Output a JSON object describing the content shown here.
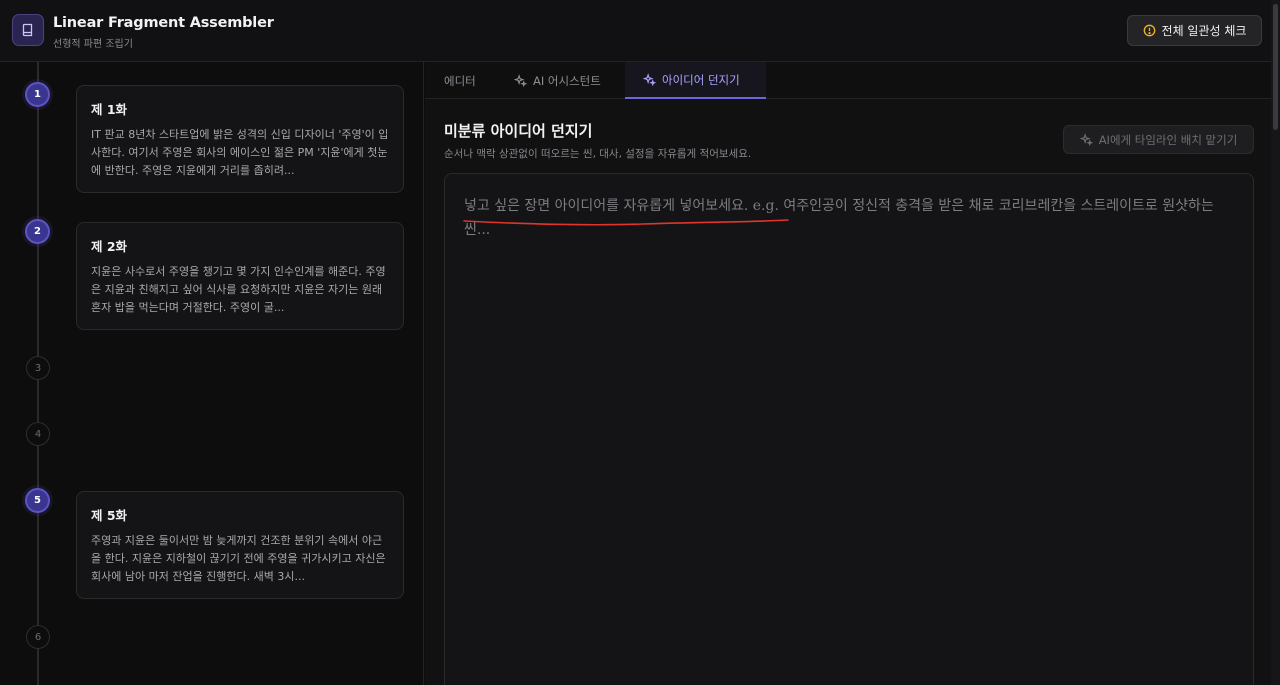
{
  "header": {
    "title": "Linear Fragment Assembler",
    "subtitle": "선형적 파편 조립기",
    "logo_icon": "book-icon",
    "consistency_button": "전체 일관성 체크",
    "consistency_icon": "alert-circle-icon"
  },
  "timeline": {
    "nodes": [
      {
        "number": "1",
        "active": true,
        "title": "제 1화",
        "body": "IT 판교 8년차 스타트업에 밝은 성격의 신입 디자이너 '주영'이 입사한다. 여기서 주영은 회사의 에이스인 젊은 PM '지윤'에게 첫눈에 반한다. 주영은 지윤에게 거리를 좁히려..."
      },
      {
        "number": "2",
        "active": true,
        "title": "제 2화",
        "body": "지윤은 사수로서 주영을 챙기고 몇 가지 인수인계를 해준다. 주영은 지윤과 친해지고 싶어 식사를 요청하지만 지윤은 자기는 원래 혼자 밥을 먹는다며 거절한다. 주영이 굴..."
      },
      {
        "number": "3",
        "active": false
      },
      {
        "number": "4",
        "active": false
      },
      {
        "number": "5",
        "active": true,
        "title": "제 5화",
        "body": "주영과 지윤은 둘이서만 밤 늦게까지 건조한 분위기 속에서 야근을 한다. 지윤은 지하철이 끊기기 전에 주영을 귀가시키고 자신은 회사에 남아 마저 잔업을 진행한다. 새벽 3시..."
      },
      {
        "number": "6",
        "active": false
      }
    ]
  },
  "tabs": [
    {
      "label": "에디터",
      "icon": ""
    },
    {
      "label": "AI 어시스턴트",
      "icon": "sparkles-icon"
    },
    {
      "label": "아이디어 던지기",
      "icon": "sparkles-icon",
      "active": true
    }
  ],
  "idea": {
    "title": "미분류 아이디어 던지기",
    "description": "순서나 맥락 상관없이 떠오르는 씬, 대사, 설정을 자유롭게 적어보세요.",
    "ai_button": "AI에게 타임라인 배치 맡기기",
    "placeholder": "넣고 싶은 장면 아이디어를 자유롭게 넣어보세요. e.g. 여주인공이 정신적 충격을 받은 채로 코리브레칸을 스트레이트로 원샷하는 씬...",
    "value": ""
  },
  "colors": {
    "accent": "#6c64e0",
    "annotation": "#e0352b"
  }
}
